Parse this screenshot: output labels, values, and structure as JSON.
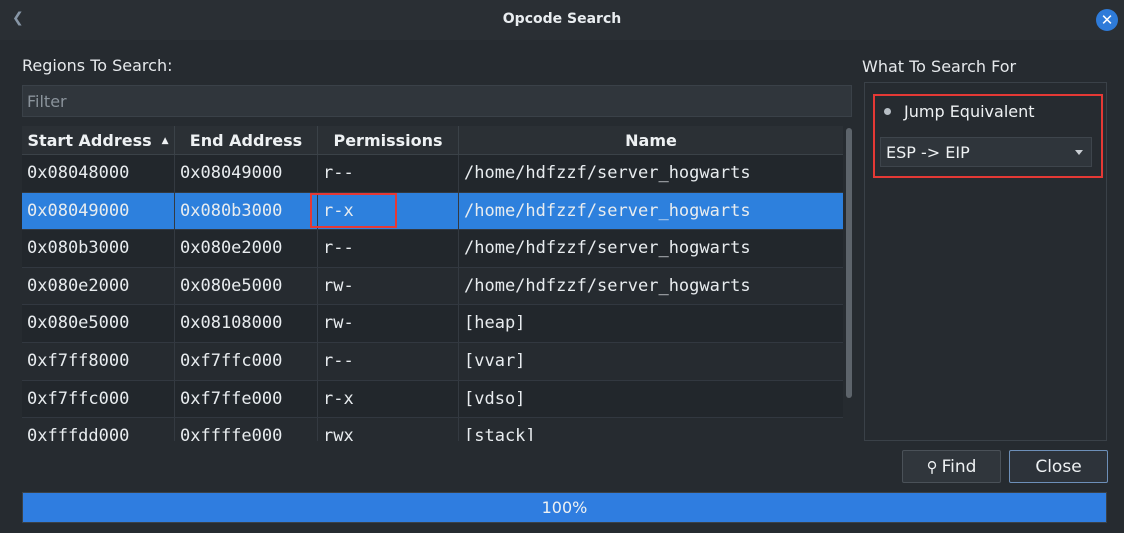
{
  "window": {
    "title": "Opcode Search",
    "close_icon": "close-icon"
  },
  "regions": {
    "label": "Regions To Search:",
    "filter_placeholder": "Filter",
    "columns": [
      "Start Address",
      "End Address",
      "Permissions",
      "Name"
    ],
    "sort_column": "Start Address",
    "sort_direction": "ascending",
    "selected_row": 1,
    "rows": [
      {
        "start": "0x08048000",
        "end": "0x08049000",
        "perm": "r--",
        "name": "/home/hdfzzf/server_hogwarts"
      },
      {
        "start": "0x08049000",
        "end": "0x080b3000",
        "perm": "r-x",
        "name": "/home/hdfzzf/server_hogwarts"
      },
      {
        "start": "0x080b3000",
        "end": "0x080e2000",
        "perm": "r--",
        "name": "/home/hdfzzf/server_hogwarts"
      },
      {
        "start": "0x080e2000",
        "end": "0x080e5000",
        "perm": "rw-",
        "name": "/home/hdfzzf/server_hogwarts"
      },
      {
        "start": "0x080e5000",
        "end": "0x08108000",
        "perm": "rw-",
        "name": "[heap]"
      },
      {
        "start": "0xf7ff8000",
        "end": "0xf7ffc000",
        "perm": "r--",
        "name": "[vvar]"
      },
      {
        "start": "0xf7ffc000",
        "end": "0xf7ffe000",
        "perm": "r-x",
        "name": "[vdso]"
      },
      {
        "start": "0xfffdd000",
        "end": "0xffffe000",
        "perm": "rwx",
        "name": "[stack]"
      }
    ]
  },
  "search_for": {
    "label": "What To Search For",
    "radio_label": "Jump Equivalent",
    "radio_selected": true,
    "select_value": "ESP -> EIP"
  },
  "buttons": {
    "find": "Find",
    "close": "Close"
  },
  "progress": {
    "value": 100,
    "label": "100%"
  },
  "colors": {
    "accent": "#2d80dd",
    "highlight_box": "#e53935",
    "background": "#262b30"
  }
}
